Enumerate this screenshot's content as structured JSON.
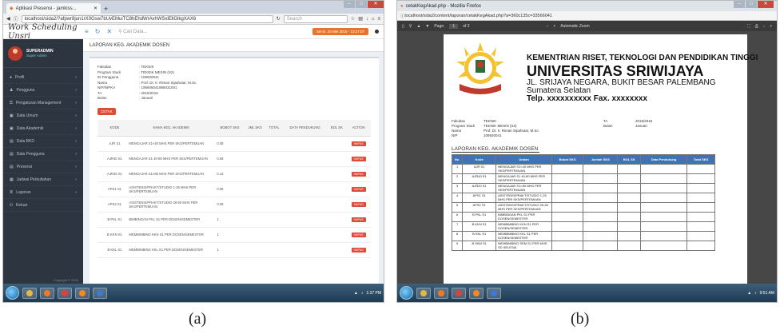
{
  "captions": {
    "a": "(a)",
    "b": "(b)"
  },
  "left": {
    "tab_title": "Aplikasi Presensi - jamkiss...",
    "new_tab": "+",
    "url": "localhost/sida2/?afpwr8jun1rX0Gsw7bUvEMuiTC8hEhdWrAvhWSxlEllGlkgXAX6",
    "search_placeholder": "Search",
    "brand": "Work Scheduling Unsri",
    "header_search": "Cari Data...",
    "date_button": "Senin, 20 Mei 2016 - 13:27:07",
    "user_name": "SUPERADMIN",
    "user_status": "Super Admin",
    "menu": [
      {
        "icon": "user-icon",
        "label": "Profil"
      },
      {
        "icon": "users-icon",
        "label": "Pengguna"
      },
      {
        "icon": "key-icon",
        "label": "Pengaturan Management"
      },
      {
        "icon": "database-icon",
        "label": "Data Umum"
      },
      {
        "icon": "database-icon",
        "label": "Data Akademik"
      },
      {
        "icon": "book-icon",
        "label": "Data BKD"
      },
      {
        "icon": "book-icon",
        "label": "Data Pengguna"
      },
      {
        "icon": "book-icon",
        "label": "Presensi"
      },
      {
        "icon": "calendar-icon",
        "label": "Jadwal Perkuliahan"
      },
      {
        "icon": "list-icon",
        "label": "Laporan"
      },
      {
        "icon": "power-icon",
        "label": "Keluar"
      }
    ],
    "copyright": "Copyright © 2016",
    "page_title": "LAPORAN KEG. AKADEMIK DOSEN",
    "info": [
      {
        "k": "Fakultas",
        "v": ": TEKNIK"
      },
      {
        "k": "Program Studi",
        "v": ": TEKNIK MESIN (S2)"
      },
      {
        "k": "ID Pengguna",
        "v": ": 109920041"
      },
      {
        "k": "Nama",
        "v": ": Prof. Dr. Ir. Riman Sipahutar, M.Sc."
      },
      {
        "k": "NIP/NIPKA",
        "v": ": 195606041986031001"
      },
      {
        "k": "TA",
        "v": ": 2015/2016"
      },
      {
        "k": "Bulan",
        "v": ": Januari"
      }
    ],
    "cetak_label": "CETAK",
    "table_headers": [
      "KODE",
      "NAMA KEG. AKADEMIK",
      "BOBOT SKS",
      "JML SKS",
      "TOTAL",
      "DATA PENDUKUNG",
      "BOL SK",
      "ACTION"
    ],
    "rows": [
      {
        "kode": "AJR S1",
        "nama": "MENGAJAR S1<40 MHS PER SKS/PERTEMUAN",
        "bobot": "0.08"
      },
      {
        "kode": "AJR40 S1",
        "nama": "MENGAJAR S1 40-80 MHS PER SKS/PERTEMUAN",
        "bobot": "0.08"
      },
      {
        "kode": "AJR20 S1",
        "nama": "MENGAJAR S1>80 MHS PER SKS/PERTEMUAN",
        "bobot": "0.13"
      },
      {
        "kode": "APS1 S1",
        "nama": "ASISTENSI/PRAKT/STUDIO 1-25 MHS PER SKS/PERTEMUAN",
        "bobot": "0.08"
      },
      {
        "kode": "APS2 S1",
        "nama": "ASISTENSI/PRAKT/STUDIO 26-50 MHS PER SKS/PERTEMUAN",
        "bobot": "0.09"
      },
      {
        "kode": "B PKL S1",
        "nama": "BIMBINGAN PKL S1 PER DOSEN/SEMESTER",
        "bobot": "1"
      },
      {
        "kode": "B KKN S1",
        "nama": "MEMBIMBING KKN S1 PER DOSEN/SEMESTER",
        "bobot": "1"
      },
      {
        "kode": "B KKL S1",
        "nama": "MEMBIMBING KKL S1 PER DOSEN/SEMESTER",
        "bobot": "1"
      }
    ],
    "action_label": "HAPUS",
    "tray_time": "1:37 PM"
  },
  "right": {
    "window_title": "cetakKegAkad.php - Mozilla Firefox",
    "url": "localhost/sida2/content/laporan/cetakKegAkad.php?a=360c135c=33566041",
    "pdf_page": "Page:",
    "pdf_of": "of 2",
    "zoom": "Automatic Zoom",
    "kop1": "KEMENTRIAN RISET, TEKNOLOGI DAN PENDIDIKAN TINGGI",
    "kop2": "UNIVERSITAS SRIWIJAYA",
    "kop3": "JL. SRIJAYA NEGARA, BUKIT BESAR PALEMBANG",
    "kop4": "Sumatera Selatan",
    "kop5": "Telp. xxxxxxxxxx Fax. xxxxxxxx",
    "info": [
      {
        "k": "Fakultas",
        "v": "TEKNIK",
        "k2": "TA",
        "v2": "2015/2016"
      },
      {
        "k": "Program Studi",
        "v": "TEKNIK MESIN (S2)",
        "k2": "Bulan",
        "v2": "Januari"
      },
      {
        "k": "Nama",
        "v": "Prof. Dr. Ir. Riman Sipahutar, M.Sc.",
        "k2": "",
        "v2": ""
      },
      {
        "k": "NIP",
        "v": "109920041",
        "k2": "",
        "v2": ""
      }
    ],
    "report_title": "LAPORAN KEG. AKADEMIK DOSEN",
    "table_headers": [
      "No.",
      "Kode",
      "Uraian",
      "Bobot SKS",
      "Jumlah SKS",
      "BOL SK",
      "Data Pendukung",
      "Total SKS"
    ],
    "rows": [
      {
        "no": "1",
        "kode": "AJR S1",
        "uraian": "MENGAJAR S1<40 MHS PER SKS/PERTEMUAN"
      },
      {
        "no": "2",
        "kode": "AJR40 S1",
        "uraian": "MENGAJAR S1 40-80 MHS PER SKS/PERTEMUAN"
      },
      {
        "no": "3",
        "kode": "AJR20 S1",
        "uraian": "MENGAJAR S1>80 MHS PER SKS/PERTEMUAN"
      },
      {
        "no": "4",
        "kode": "APS1 S1",
        "uraian": "ASISTENSI/PRAKT/STUDIO 1-25 MHS PER SKS/PERTEMUAN"
      },
      {
        "no": "5",
        "kode": "APS2 S1",
        "uraian": "ASISTENSI/PRAKT/STUDIO 26-50 MHS PER SKS/PERTEMUAN"
      },
      {
        "no": "6",
        "kode": "B PKL S1",
        "uraian": "BIMBINGAN PKL S1 PER DOSEN/SEMESTER"
      },
      {
        "no": "7",
        "kode": "B KKN S1",
        "uraian": "MEMBIMBING KKN S1 PER DOSEN/SEMESTER"
      },
      {
        "no": "8",
        "kode": "B KKL S1",
        "uraian": "MEMBIMBING KKL S1 PER DOSEN/SEMESTER"
      },
      {
        "no": "9",
        "kode": "B SKM S1",
        "uraian": "MEMBIMBING SEM S1 PER MHS SD SELESAI"
      }
    ],
    "tray_time": "9:51 AM"
  },
  "colors": {
    "sidebar": "#2d3540",
    "accent": "#3c8dbc",
    "danger": "#dd4b39",
    "pdf_header": "#3f73b5"
  }
}
